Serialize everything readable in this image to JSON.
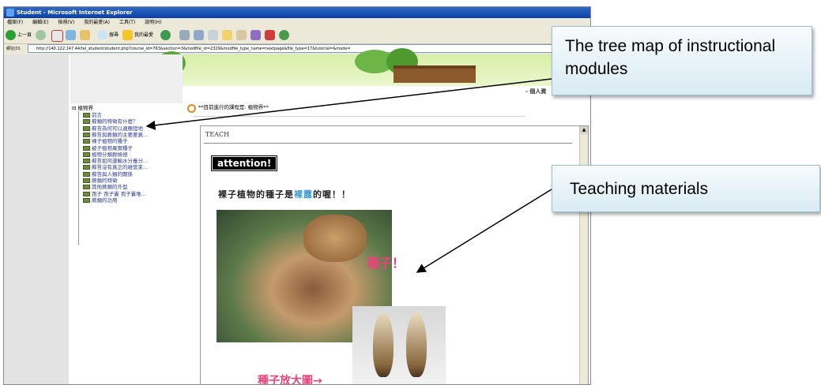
{
  "browser": {
    "title": "Student - Microsoft Internet Explorer",
    "menu": [
      "檔案(F)",
      "編輯(E)",
      "檢視(V)",
      "我的最愛(A)",
      "工具(T)",
      "說明(H)"
    ],
    "toolbar": {
      "back_label": "上一頁",
      "search_label": "搜尋",
      "favorites_label": "我的最愛"
    },
    "address_label": "網址(D)",
    "address_url": "http://140.122.147.44/tel_student/student.php?course_id=763&section=3&modfile_id=2329&modfile_type_name=nextpage&file_type=17&tutorial=&mode="
  },
  "page": {
    "personal_link": "- 個人資",
    "course_text": "**目前進行的課程是: 植物界**",
    "tree": {
      "root": "植物界",
      "items": [
        "前言",
        "蘚類的特徵有什麼？",
        "蘚苔為何可以適應陸地",
        "蘚苔與蕨類的主要差異...",
        "裸子植物的種子",
        "被子植物果實種子",
        "植物分類群檢視",
        "蘚苔如何運輸水分養分...",
        "蘚苔沒有真正的維管束...",
        "蘚苔與人類的關係",
        "蕨類的特徵",
        "其他蕨類的外型",
        "孢子 孢子囊 孢子囊堆...",
        "蕨類的功用"
      ]
    },
    "content": {
      "header": "TEACH",
      "attention": "attention!",
      "caption_prefix": "裸子植物的種子是",
      "caption_highlight": "裸露",
      "caption_suffix": "的喔！！",
      "seed_label": "種子！",
      "caption2": "種子放大圖→"
    }
  },
  "callouts": {
    "tree_map": "The tree map of instructional modules",
    "teaching": "Teaching materials"
  }
}
